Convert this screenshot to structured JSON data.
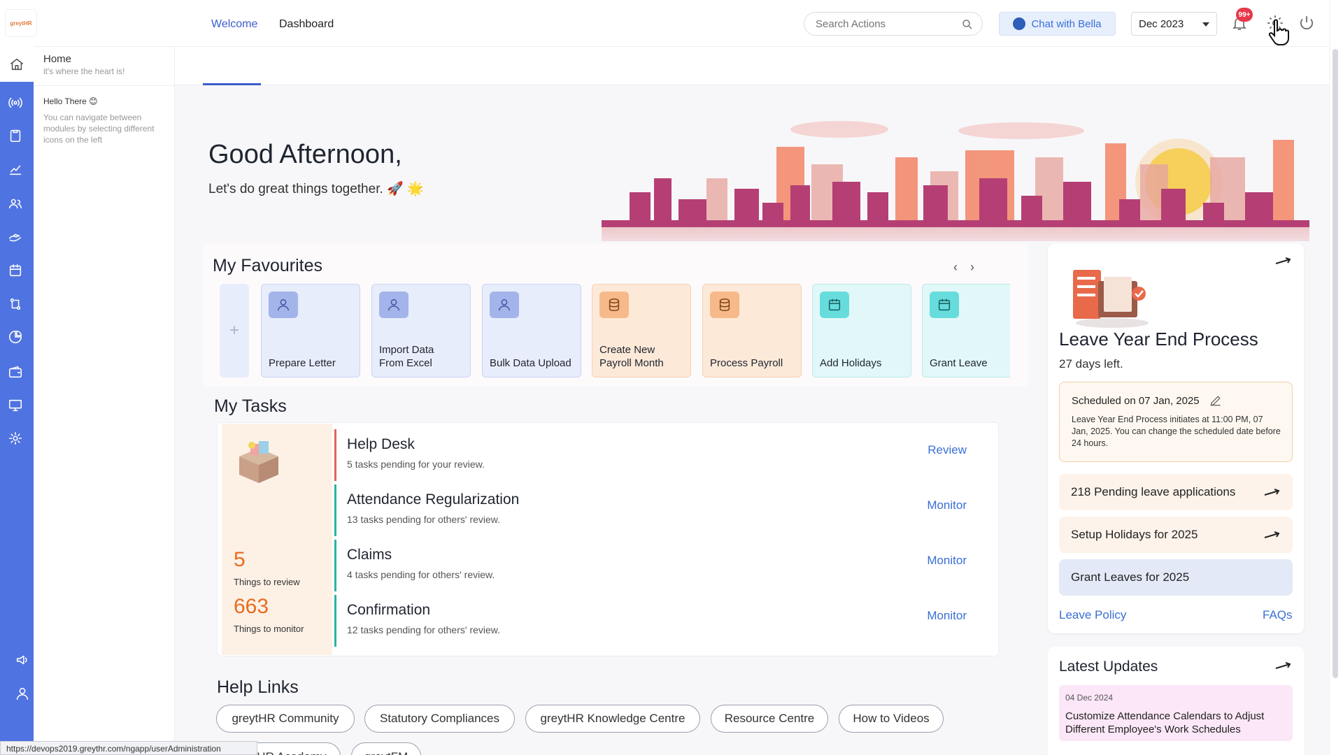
{
  "topbar": {
    "logo_text": "greytHR",
    "search_placeholder": "Search Actions",
    "chat_label": "Chat with Bella",
    "period": "Dec 2023",
    "notification_badge": "99+"
  },
  "home_panel": {
    "title": "Home",
    "subtitle": "it's where the heart is!",
    "hello": "Hello There 😊",
    "hello_desc": "You can navigate between modules by selecting different icons on the left"
  },
  "tabs": [
    "Welcome",
    "Dashboard"
  ],
  "hero": {
    "greeting": "Good Afternoon,",
    "subtitle": "Let's do great things together. 🚀 🌟"
  },
  "favourites": {
    "title": "My Favourites",
    "items": [
      {
        "label": "Prepare Letter",
        "icon": "user-icon",
        "tone": "blue"
      },
      {
        "label": "Import Data From Excel",
        "icon": "user-icon",
        "tone": "blue"
      },
      {
        "label": "Bulk Data Upload",
        "icon": "user-icon",
        "tone": "blue"
      },
      {
        "label": "Create New Payroll Month",
        "icon": "database-icon",
        "tone": "orange"
      },
      {
        "label": "Process Payroll",
        "icon": "database-icon",
        "tone": "orange"
      },
      {
        "label": "Add Holidays",
        "icon": "calendar-icon",
        "tone": "teal"
      },
      {
        "label": "Grant Leave",
        "icon": "calendar-icon",
        "tone": "teal"
      }
    ]
  },
  "tasks": {
    "title": "My Tasks",
    "review_count": "5",
    "review_label": "Things to review",
    "monitor_count": "663",
    "monitor_label": "Things to monitor",
    "items": [
      {
        "title": "Help Desk",
        "desc": "5 tasks pending for your review.",
        "action": "Review",
        "bar": "#e2655a"
      },
      {
        "title": "Attendance Regularization",
        "desc": "13 tasks pending for others' review.",
        "action": "Monitor",
        "bar": "#2bb3a3"
      },
      {
        "title": "Claims",
        "desc": "4 tasks pending for others' review.",
        "action": "Monitor",
        "bar": "#2bb3a3"
      },
      {
        "title": "Confirmation",
        "desc": "12 tasks pending for others' review.",
        "action": "Monitor",
        "bar": "#2bb3a3"
      }
    ]
  },
  "help_links": {
    "title": "Help Links",
    "row1": [
      "greytHR Community",
      "Statutory Compliances",
      "greytHR Knowledge Centre",
      "Resource Centre",
      "How to Videos"
    ],
    "row2": [
      "greytHR Academy",
      "greytFM"
    ]
  },
  "leave_process": {
    "title": "Leave Year End Process",
    "days_left": "27 days left.",
    "scheduled": "Scheduled on 07 Jan, 2025",
    "scheduled_desc": "Leave Year End Process initiates at 11:00 PM, 07 Jan, 2025. You can change the scheduled date before 24 hours.",
    "items": [
      {
        "label": "218 Pending leave applications",
        "bg": "#fdf3ea"
      },
      {
        "label": "Setup Holidays for 2025",
        "bg": "#fdf3ea"
      },
      {
        "label": "Grant Leaves for 2025",
        "bg": "#e4e9f7"
      }
    ],
    "leave_policy": "Leave Policy",
    "faqs": "FAQs"
  },
  "latest_updates": {
    "title": "Latest Updates",
    "date": "04 Dec 2024",
    "text": "Customize Attendance Calendars to Adjust Different Employee's Work Schedules"
  },
  "status_url": "https://devops2019.greythr.com/ngapp/userAdministration",
  "colors": {
    "rail": "#4f73e0",
    "accent": "#3b5ccc",
    "orange_number": "#e86c1f"
  }
}
